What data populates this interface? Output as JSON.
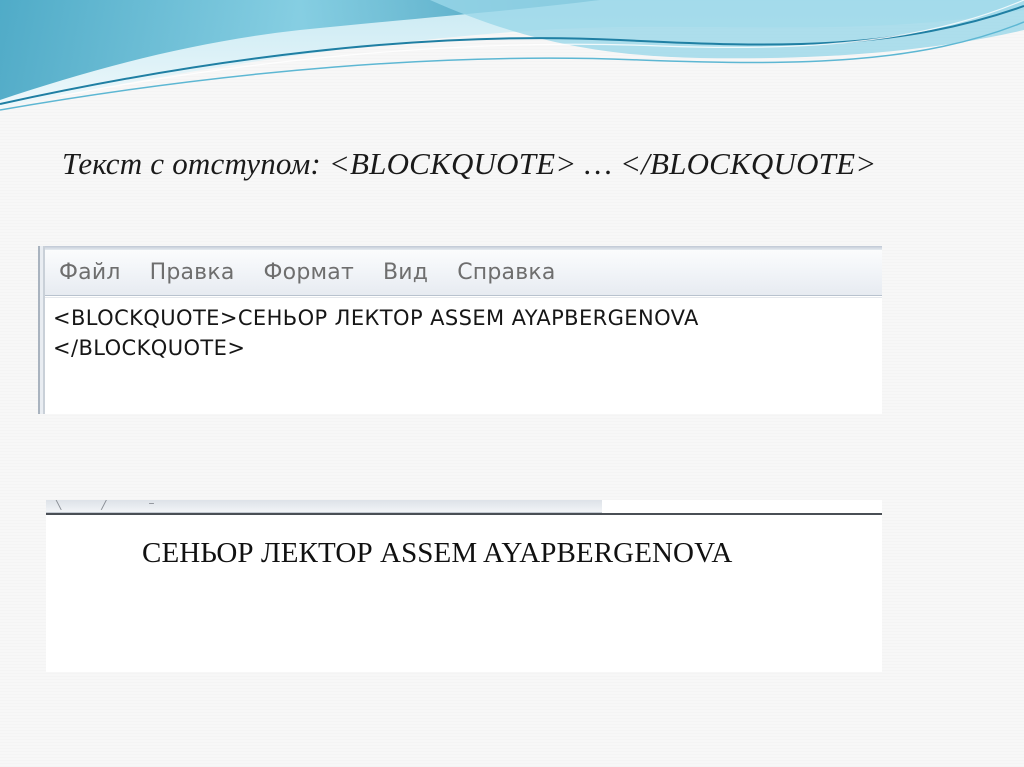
{
  "slide": {
    "title": "Текст с отступом: <BLOCKQUOTE> … </BLOCKQUOTE>"
  },
  "notepad": {
    "menu": [
      "Файл",
      "Правка",
      "Формат",
      "Вид",
      "Справка"
    ],
    "lines": [
      "<BLOCKQUOTE>СЕНЬОР ЛЕКТОР ASSEM AYAPBERGENOVA",
      "</BLOCKQUOTE>"
    ]
  },
  "browser": {
    "rendered_text": "СЕНЬОР ЛЕКТОР ASSEM AYAPBERGENOVA"
  },
  "colors": {
    "wave_dark": "#2a8fb0",
    "wave_light": "#8fd3e6",
    "title_text": "#1a1a1a",
    "menu_text": "#6e6e6e"
  }
}
